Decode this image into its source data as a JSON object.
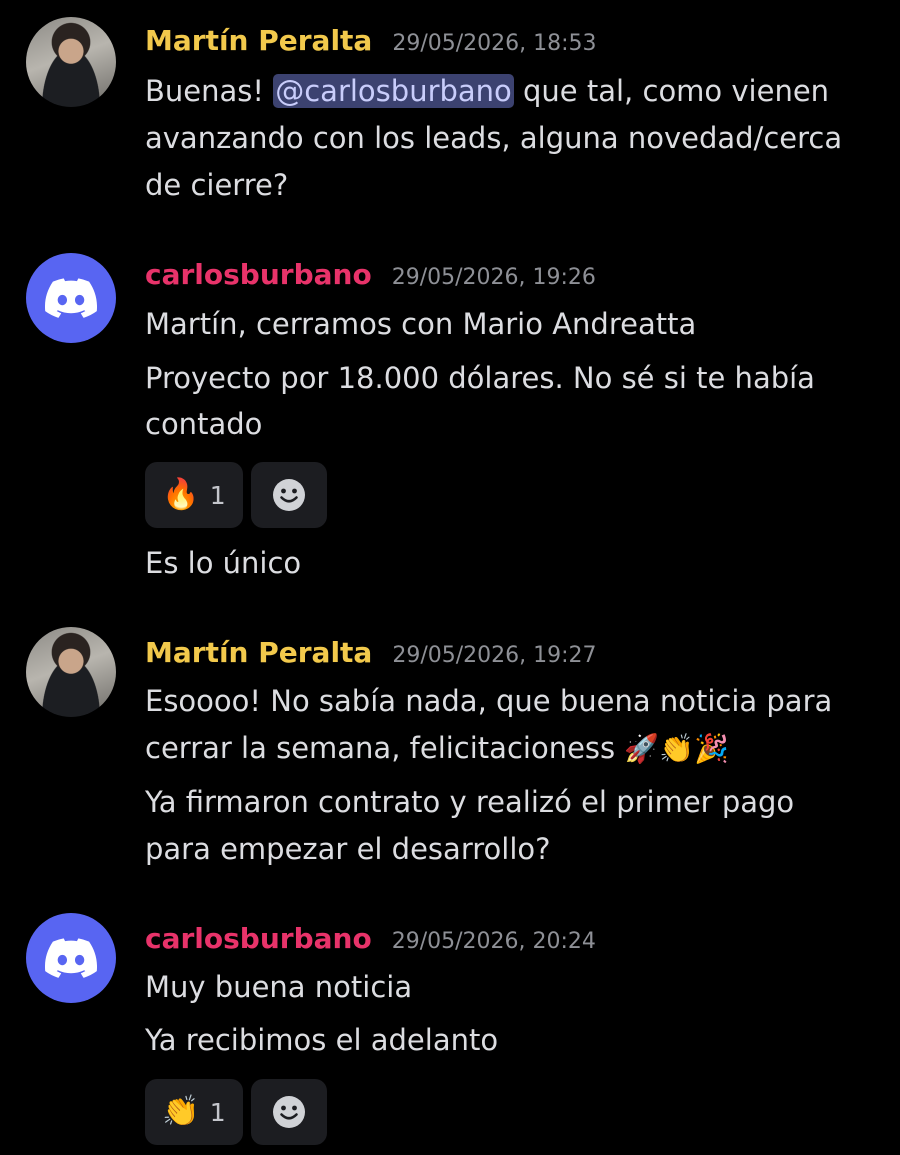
{
  "colors": {
    "background": "#000000",
    "martin_name": "#f2c94c",
    "carlos_name": "#e8336a",
    "discord_blurple": "#5865f2",
    "message_text": "#dcdde1",
    "timestamp": "#8e9096",
    "reaction_bg": "#1c1d21"
  },
  "messages": [
    {
      "author": "Martín Peralta",
      "avatar": "profile-photo",
      "timestamp": "29/05/2026, 18:53",
      "line1_pre": "Buenas! ",
      "line1_mention": "@carlosburbano",
      "line1_post": " que tal, como vienen",
      "line2": "avanzando con los leads, alguna novedad/cerca",
      "line3": "de cierre?"
    },
    {
      "author": "carlosburbano",
      "avatar": "discord-default-icon",
      "timestamp": "29/05/2026, 19:26",
      "line1": "Martín, cerramos con Mario Andreatta",
      "line2": "Proyecto por 18.000 dólares. No sé si te había",
      "line3": "contado",
      "reaction": {
        "emoji": "🔥",
        "icon": "fire-icon",
        "count": "1"
      },
      "followup": "Es lo único"
    },
    {
      "author": "Martín Peralta",
      "avatar": "profile-photo",
      "timestamp": "29/05/2026, 19:27",
      "line1": "Esoooo! No sabía nada, que buena noticia para",
      "line2_text": "cerrar la semana, felicitacioness ",
      "line2_emojis": "🚀👏🎉",
      "line3": "Ya firmaron contrato y realizó el primer pago",
      "line4": "para empezar el desarrollo?"
    },
    {
      "author": "carlosburbano",
      "avatar": "discord-default-icon",
      "timestamp": "29/05/2026, 20:24",
      "line1": "Muy buena noticia",
      "line2": "Ya recibimos el adelanto",
      "reaction": {
        "emoji": "👏",
        "icon": "clapping-hands-icon",
        "count": "1"
      }
    }
  ]
}
